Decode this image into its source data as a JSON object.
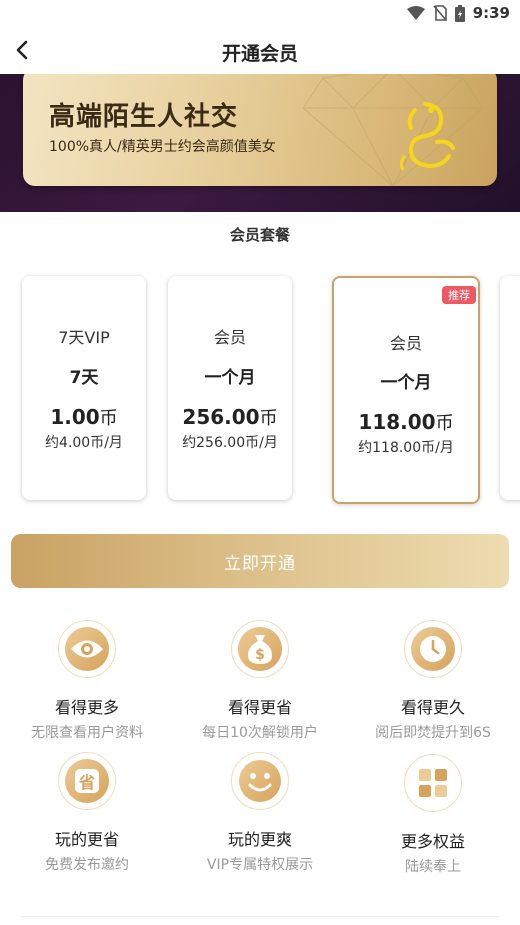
{
  "status": {
    "time": "9:39"
  },
  "nav": {
    "title": "开通会员"
  },
  "hero": {
    "title": "高端陌生人社交",
    "subtitle": "100%真人/精英男士约会高颜值美女"
  },
  "section_title": "会员套餐",
  "plans": [
    {
      "name": "7天VIP",
      "duration": "7天",
      "price": "1.00",
      "unit": "币",
      "monthly": "约4.00币/月",
      "badge": ""
    },
    {
      "name": "会员",
      "duration": "一个月",
      "price": "256.00",
      "unit": "币",
      "monthly": "约256.00币/月",
      "badge": ""
    },
    {
      "name": "会员",
      "duration": "一个月",
      "price": "118.00",
      "unit": "币",
      "monthly": "约118.00币/月",
      "badge": "推荐"
    }
  ],
  "cta_label": "立即开通",
  "benefits": [
    {
      "title": "看得更多",
      "subtitle": "无限查看用户资料",
      "icon": "eye-icon"
    },
    {
      "title": "看得更省",
      "subtitle": "每日10次解锁用户",
      "icon": "money-bag-icon"
    },
    {
      "title": "看得更久",
      "subtitle": "阅后即焚提升到6S",
      "icon": "clock-icon"
    },
    {
      "title": "玩的更省",
      "subtitle": "免费发布邀约",
      "icon": "save-icon"
    },
    {
      "title": "玩的更爽",
      "subtitle": "VIP专属特权展示",
      "icon": "smile-icon"
    },
    {
      "title": "更多权益",
      "subtitle": "陆续奉上",
      "icon": "grid-icon"
    }
  ],
  "icons": {
    "save_glyph": "省",
    "money_glyph": "$"
  },
  "colors": {
    "accent_gold": "#c9a468",
    "badge_red": "#ee5a64",
    "hero_bg": "#2c1230"
  }
}
